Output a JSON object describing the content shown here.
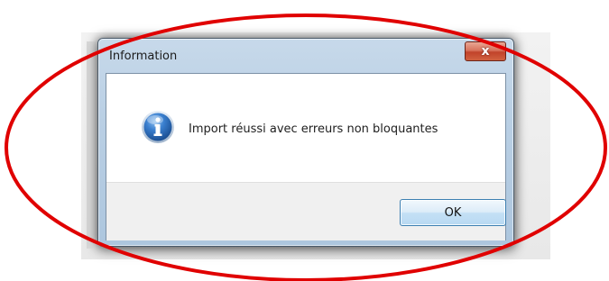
{
  "dialog": {
    "title": "Information",
    "close_label": "x",
    "message": "Import réussi avec erreurs non bloquantes",
    "ok_label": "OK",
    "icon": "info-icon"
  },
  "annotation": {
    "shape": "ellipse",
    "color": "#e00000"
  },
  "colors": {
    "close_button": "#c1432b",
    "ok_button_border": "#3c7fb1",
    "info_icon": "#2466b0"
  }
}
